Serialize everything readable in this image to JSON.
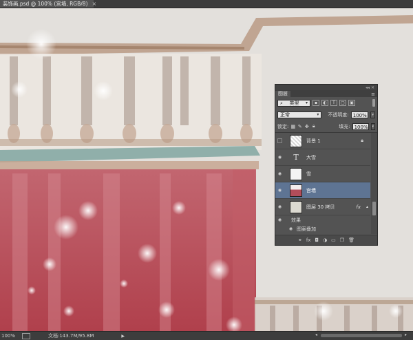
{
  "document": {
    "tab_title": "装饰画.psd @ 100% (宫墙, RGB/8)",
    "close_glyph": "×"
  },
  "statusbar": {
    "zoom": "100%",
    "doc_info": "文档:143.7M/95.8M",
    "arrow": "▶"
  },
  "layers_panel": {
    "header_controls": "◂◂ ✕",
    "tab_label": "图层",
    "menu_glyph": "≡",
    "filter": {
      "kind_label": "类型",
      "kind_icon": "search-icon"
    },
    "blend_mode": "正常",
    "opacity_label": "不透明度:",
    "opacity_value": "100%",
    "lock_label": "锁定:",
    "fill_label": "填充:",
    "fill_value": "100%",
    "layers": [
      {
        "name": "背景 1",
        "type": "image",
        "visible": false,
        "locked": true
      },
      {
        "name": "大雪",
        "type": "text",
        "visible": true
      },
      {
        "name": "雪",
        "type": "image",
        "visible": true
      },
      {
        "name": "宫墙",
        "type": "image",
        "visible": true,
        "selected": true
      },
      {
        "name": "图层 30 拷贝",
        "type": "image",
        "visible": true,
        "fx": true
      }
    ],
    "effects": {
      "label": "效果",
      "items": [
        "图案叠加"
      ]
    },
    "fx_glyph": "fx",
    "footer_icons": [
      "link-icon",
      "fx-icon",
      "mask-icon",
      "adjustment-icon",
      "group-icon",
      "new-layer-icon",
      "trash-icon"
    ]
  },
  "colors": {
    "panel": "#535353",
    "selected_layer": "#5e7493",
    "wall_red": "#b54450",
    "teal": "#86aaa4",
    "wood": "#a57f62"
  }
}
